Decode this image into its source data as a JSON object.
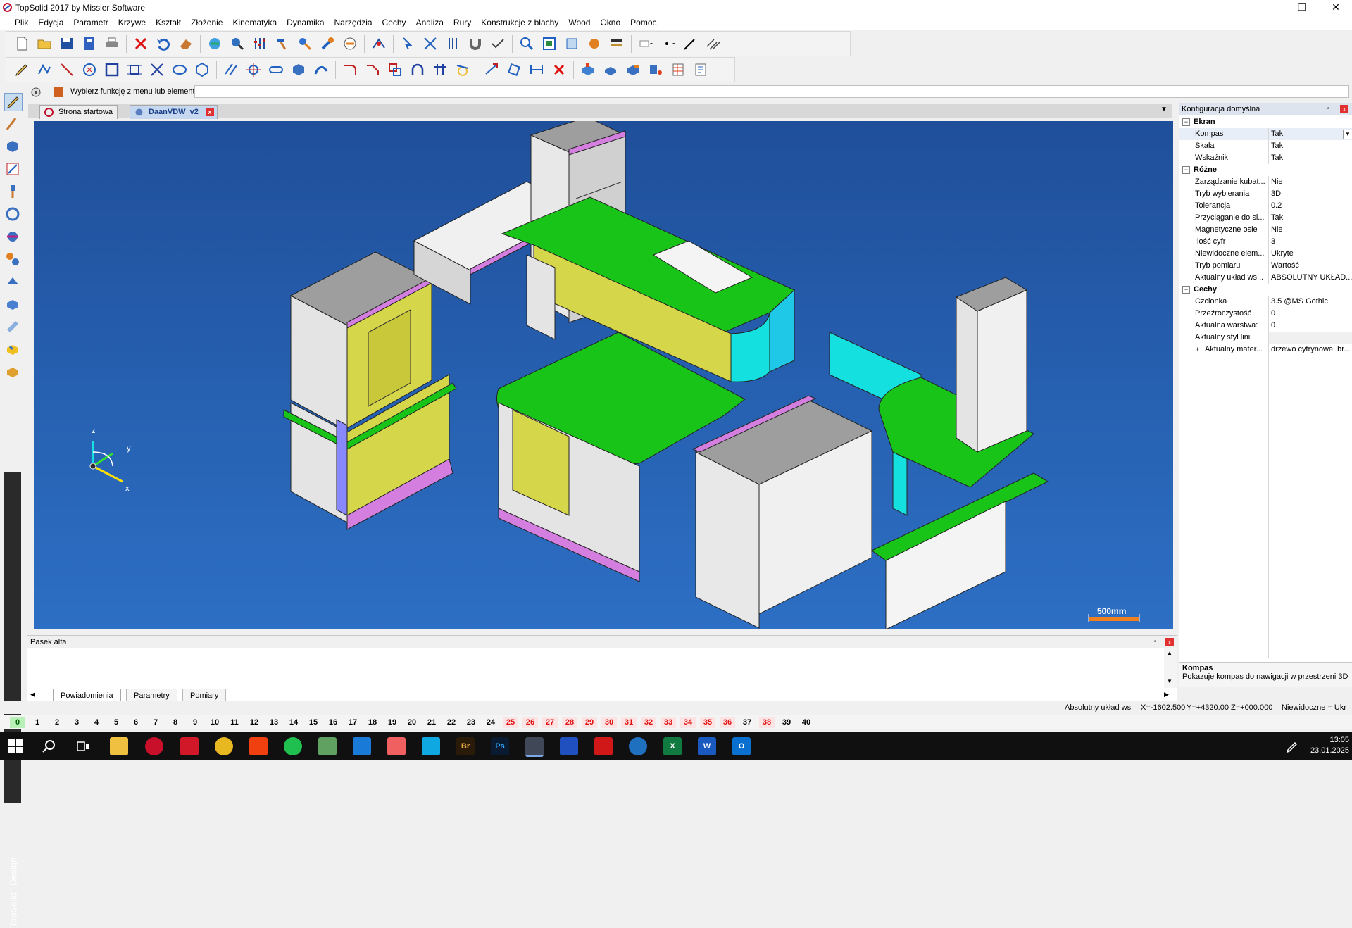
{
  "window": {
    "title": "TopSolid 2017 by Missler Software",
    "minimize": "—",
    "maximize": "❐",
    "close": "✕"
  },
  "menu": [
    "Plik",
    "Edycja",
    "Parametr",
    "Krzywe",
    "Kształt",
    "Złożenie",
    "Kinematyka",
    "Dynamika",
    "Narzędzia",
    "Cechy",
    "Analiza",
    "Rury",
    "Konstrukcje z blachy",
    "Wood",
    "Okno",
    "Pomoc"
  ],
  "prompt": {
    "label": "Wybierz funkcję z menu lub element:",
    "value": ""
  },
  "tabs": [
    {
      "label": "Strona startowa",
      "active": false
    },
    {
      "label": "DaanVDW_v2",
      "active": true,
      "close": "x"
    }
  ],
  "tab_dropdown": "▼",
  "viewport": {
    "axes": {
      "x": "x",
      "y": "y",
      "z": "z"
    },
    "scale_label": "500mm",
    "colors": {
      "bg_top": "#1f4f9a",
      "bg_bottom": "#2d6fc4",
      "countertop": "#18c418",
      "door": "#d6d64a",
      "trim": "#d47fe0",
      "cabinet": "#e6e6e6",
      "glass": "#14e0e0"
    }
  },
  "right_panel": {
    "title": "Konfiguracja domyślna",
    "sections": [
      {
        "name": "Ekran",
        "rows": [
          {
            "label": "Kompas",
            "value": "Tak",
            "dropdown": true
          },
          {
            "label": "Skala",
            "value": "Tak"
          },
          {
            "label": "Wskaźnik",
            "value": "Tak"
          }
        ]
      },
      {
        "name": "Różne",
        "rows": [
          {
            "label": "Zarządzanie kubat...",
            "value": "Nie"
          },
          {
            "label": "Tryb wybierania",
            "value": "3D"
          },
          {
            "label": "Tolerancja",
            "value": "0.2"
          },
          {
            "label": "Przyciąganie do si...",
            "value": "Tak"
          },
          {
            "label": "Magnetyczne osie",
            "value": "Nie"
          },
          {
            "label": "Ilość cyfr",
            "value": "3"
          },
          {
            "label": "Niewidoczne elem...",
            "value": "Ukryte"
          },
          {
            "label": "Tryb pomiaru",
            "value": "Wartość"
          },
          {
            "label": "Aktualny układ ws...",
            "value": "ABSOLUTNY UKŁAD..."
          }
        ]
      },
      {
        "name": "Cechy",
        "rows": [
          {
            "label": "Czcionka",
            "value": "3.5  @MS Gothic"
          },
          {
            "label": "Przeźroczystość",
            "value": "0"
          },
          {
            "label": "Aktualna warstwa:",
            "value": "0"
          },
          {
            "label": "Aktualny styl linii",
            "value": ""
          },
          {
            "label": "Aktualny mater...",
            "value": "drzewo cytrynowe, br...",
            "expand": true
          }
        ]
      }
    ],
    "description": {
      "title": "Kompas",
      "text": "Pokazuje kompas do nawigacji w przestrzeni 3D"
    }
  },
  "alpha_bar": {
    "title": "Pasek alfa",
    "tabs": [
      "Powiadomienia",
      "Parametry",
      "Pomiary"
    ]
  },
  "status": {
    "coord_system": "Absolutny układ ws",
    "x": "X=-1602.500",
    "y": "Y=+4320.00",
    "z": "Z=+000.000",
    "hidden": "Niewidoczne = Ukr"
  },
  "layers": {
    "numbers": [
      "0",
      "1",
      "2",
      "3",
      "4",
      "5",
      "6",
      "7",
      "8",
      "9",
      "10",
      "11",
      "12",
      "13",
      "14",
      "15",
      "16",
      "17",
      "18",
      "19",
      "20",
      "21",
      "22",
      "23",
      "24",
      "25",
      "26",
      "27",
      "28",
      "29",
      "30",
      "31",
      "32",
      "33",
      "34",
      "35",
      "36",
      "37",
      "38",
      "39",
      "40"
    ],
    "active": "0",
    "red": [
      "25",
      "26",
      "27",
      "28",
      "29",
      "30",
      "31",
      "32",
      "33",
      "34",
      "35",
      "36",
      "38"
    ]
  },
  "brand": "TopSolid ' Design",
  "taskbar": {
    "time": "13:05",
    "date": "23.01.2025",
    "apps": [
      "windows-start",
      "search",
      "task-view",
      "file-explorer",
      "acrobat",
      "dashlane",
      "chrome",
      "brave",
      "spotify",
      "notepad",
      "vscode",
      "asana",
      "cursor",
      "bridge",
      "photoshop",
      "topsolid",
      "app-blue",
      "solidworks",
      "app-3d",
      "excel",
      "word",
      "outlook"
    ],
    "labels": {
      "bridge": "Br",
      "photoshop": "Ps",
      "excel": "X",
      "word": "W",
      "outlook": "O"
    }
  }
}
